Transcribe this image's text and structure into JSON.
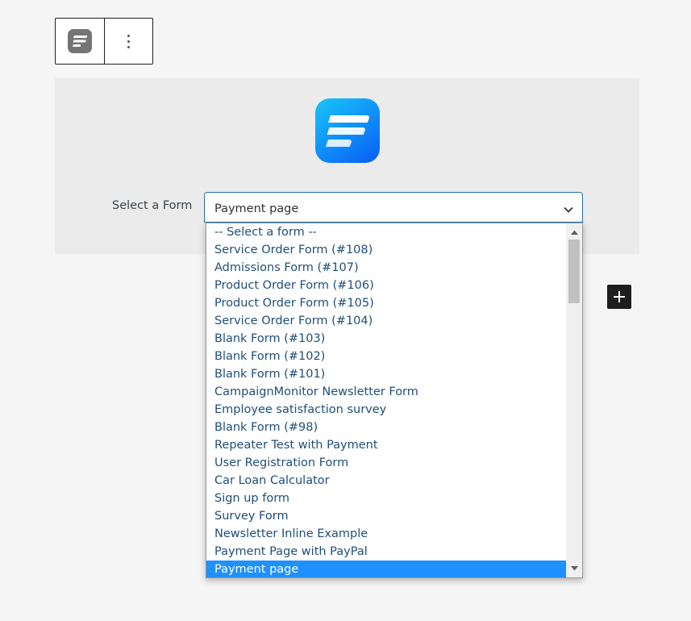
{
  "toolbar": {
    "block_icon": "fluent-forms-icon",
    "more_icon": "more-vertical-icon"
  },
  "block": {
    "logo_icon": "fluent-forms-logo-icon",
    "select_label": "Select a Form",
    "select_value": "Payment page"
  },
  "dropdown": {
    "options": [
      "-- Select a form --",
      "Service Order Form (#108)",
      "Admissions Form (#107)",
      "Product Order Form (#106)",
      "Product Order Form (#105)",
      "Service Order Form (#104)",
      "Blank Form (#103)",
      "Blank Form (#102)",
      "Blank Form (#101)",
      "CampaignMonitor Newsletter Form",
      "Employee satisfaction survey",
      "Blank Form (#98)",
      "Repeater Test with Payment",
      "User Registration Form",
      "Car Loan Calculator",
      "Sign up form",
      "Survey Form",
      "Newsletter Inline Example",
      "Payment Page with PayPal",
      "Payment page"
    ],
    "selected_option": "Payment page"
  },
  "colors": {
    "accent": "#2271b1",
    "option_text": "#1f4e79",
    "selected_bg": "#1e90ff",
    "logo_gradient_start": "#19c6f5",
    "logo_gradient_end": "#0a5cf0"
  }
}
